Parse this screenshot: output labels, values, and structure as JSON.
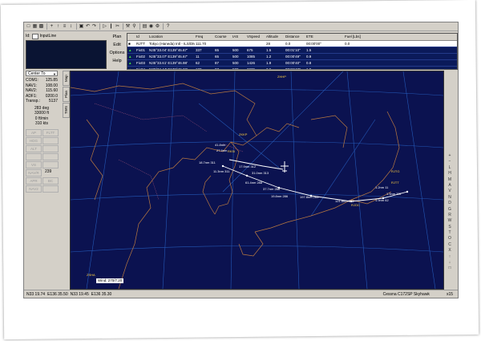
{
  "id_label": "Id:",
  "id_input": "InputLine",
  "plan_menu": [
    "Plan",
    "Edit",
    "Options",
    "Help"
  ],
  "fp_headers": [
    "",
    "Id",
    "Location",
    "Freq",
    "Course",
    "IAS",
    "VSpeed",
    "Altitude",
    "Distance",
    "ETE",
    "Fuel [Lbs]"
  ],
  "fp_rows": [
    [
      "■",
      "RJTT",
      "Tokyo (Haneda) Intl - ILS/DME",
      "111.70",
      "",
      "",
      "",
      "28",
      "0.0",
      "00:00'00\"",
      "0.0"
    ],
    [
      "▲",
      "Fix01",
      "N35°33.04' E139°45.67'",
      "337",
      "65",
      "500",
      "675",
      "1.5",
      "00:01'10\"",
      "1.5"
    ],
    [
      "▲",
      "Fix02",
      "N35°33.07' E139°45.67'",
      "11",
      "65",
      "500",
      "1085",
      "1.2",
      "00:00'49\"",
      "0.9"
    ],
    [
      "▲",
      "Fix03",
      "N35°33.61' E139°46.98'",
      "62",
      "87",
      "500",
      "1426",
      "1.9",
      "00:00'40\"",
      "0.8"
    ],
    [
      "▲",
      "Fix04",
      "N35°34.44' E139°46.22'",
      "100",
      "87",
      "500",
      "2276",
      "2.6",
      "00:01'42\"",
      "1.9"
    ]
  ],
  "center_select": "Center To",
  "radios": [
    {
      "k": "COM1:",
      "v": "125.85"
    },
    {
      "k": "NAV1:",
      "v": "108.00"
    },
    {
      "k": "NAV2:",
      "v": "115.60"
    },
    {
      "k": "ADF1:",
      "v": "0200.0"
    },
    {
      "k": "Transp.:",
      "v": "5137"
    }
  ],
  "heading": "283 deg",
  "altitude": "33000 ft",
  "vspeed": "0 ft/min",
  "speed": "310 kts",
  "buttons": [
    "AP",
    "FLTT",
    "HDG",
    "",
    "ALT",
    "",
    "",
    "",
    "VS",
    "",
    "NAV/R",
    "239",
    "APR",
    "BC",
    "NAV2",
    ""
  ],
  "vtabs": [
    "Map",
    "Plan",
    "TWS"
  ],
  "wind": "Wind: 270/7.20",
  "status": {
    "coord1": "N33 19.74",
    "coord2": "E136 35.50",
    "coord3": "N33 19.45",
    "coord4": "E136 35.30",
    "aircraft": "Cessna C172SP Skyhawk",
    "zoom": "x15"
  },
  "map_labels": [
    {
      "t": "ZHHP"
    },
    {
      "t": "ZKKP"
    },
    {
      "t": "RJTG"
    },
    {
      "t": "RKSI"
    },
    {
      "t": "ZSHA"
    },
    {
      "t": "RJOC"
    },
    {
      "t": "RJTT"
    },
    {
      "t": "41.8nm"
    },
    {
      "t": "27.9nm"
    },
    {
      "t": "18.7nm 311"
    },
    {
      "t": "17.9nm 312"
    },
    {
      "t": "31.0nm 313"
    },
    {
      "t": "11.3nm 311"
    },
    {
      "t": "61.4nm 288"
    },
    {
      "t": "37.7nm 286"
    },
    {
      "t": "19.8nm 286"
    },
    {
      "t": "197.8nm 283"
    },
    {
      "t": "121.8nm 283"
    },
    {
      "t": "1.2nm 11"
    },
    {
      "t": "1.5nm 337"
    },
    {
      "t": "1.9nm 62"
    }
  ],
  "colors": {
    "map_bg": "#0b1250",
    "coast": "#b87840",
    "route": "#ffffff",
    "grid": "#2a6ad0",
    "table_bg": "#0b1a5a"
  }
}
